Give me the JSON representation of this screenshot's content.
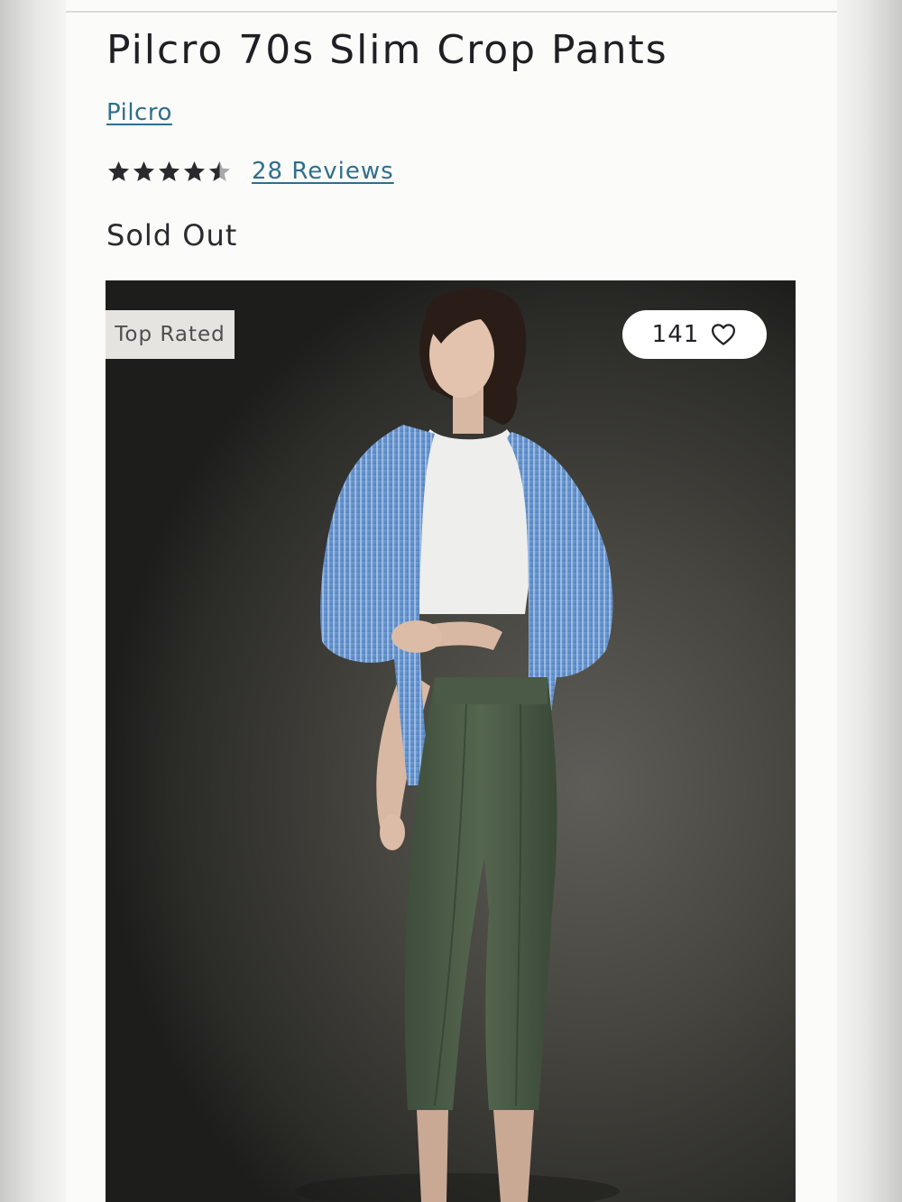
{
  "product": {
    "title": "Pilcro 70s Slim Crop Pants",
    "brand": "Pilcro",
    "rating": 4.5,
    "rating_max": 5,
    "reviews_label": "28 Reviews",
    "stock_status": "Sold Out"
  },
  "image": {
    "badge": "Top Rated",
    "wishlist_count": "141",
    "wishlist_icon": "heart-outline-icon",
    "description": "model-photo"
  },
  "colors": {
    "link": "#2e6f8c",
    "text": "#1f1f24",
    "star": "#2a2a2e",
    "background": "#fbfbf9"
  }
}
